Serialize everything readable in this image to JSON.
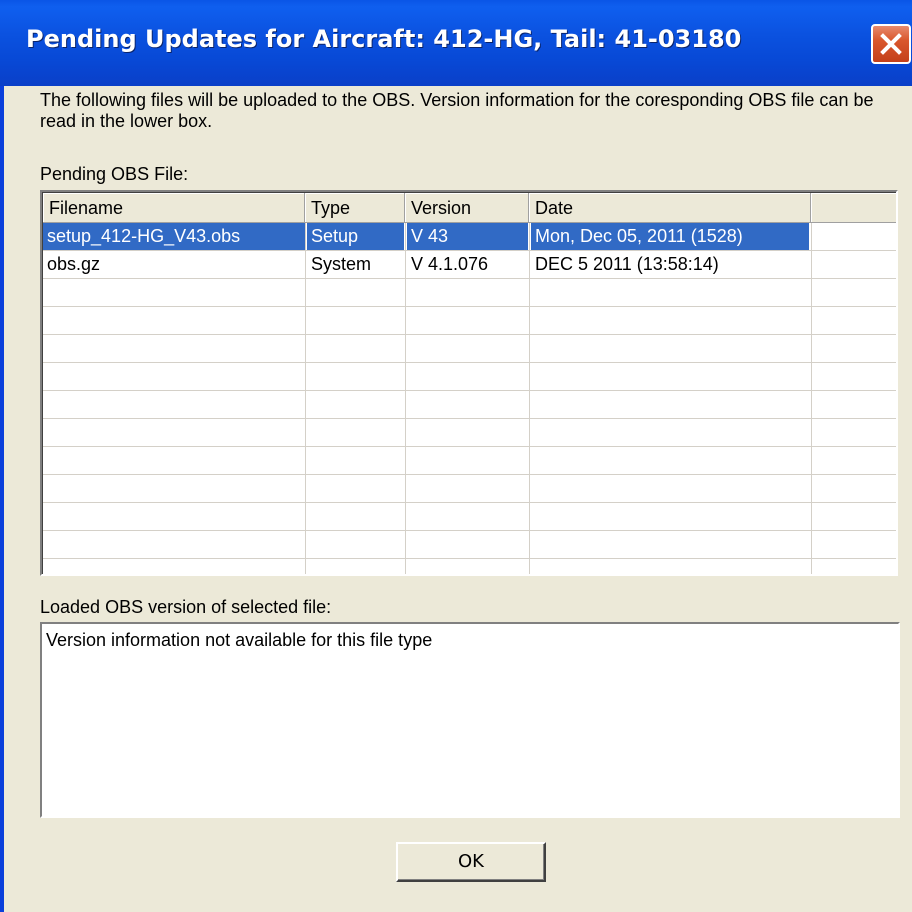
{
  "window": {
    "title": "Pending Updates for Aircraft: 412-HG, Tail: 41-03180"
  },
  "description": "The following files will be uploaded to the OBS.  Version information for the coresponding OBS file can be read in the lower box.",
  "pending_label": "Pending OBS File:",
  "table": {
    "columns": [
      "Filename",
      "Type",
      "Version",
      "Date"
    ],
    "rows": [
      {
        "filename": "setup_412-HG_V43.obs",
        "type": "Setup",
        "version": "V 43",
        "date": "Mon, Dec 05, 2011 (1528)",
        "selected": true
      },
      {
        "filename": "obs.gz",
        "type": "System",
        "version": "V 4.1.076",
        "date": "DEC 5 2011 (13:58:14)",
        "selected": false
      }
    ]
  },
  "loaded_label": "Loaded OBS version of selected file:",
  "loaded_text": "Version information not available for this file type",
  "ok_label": "OK"
}
